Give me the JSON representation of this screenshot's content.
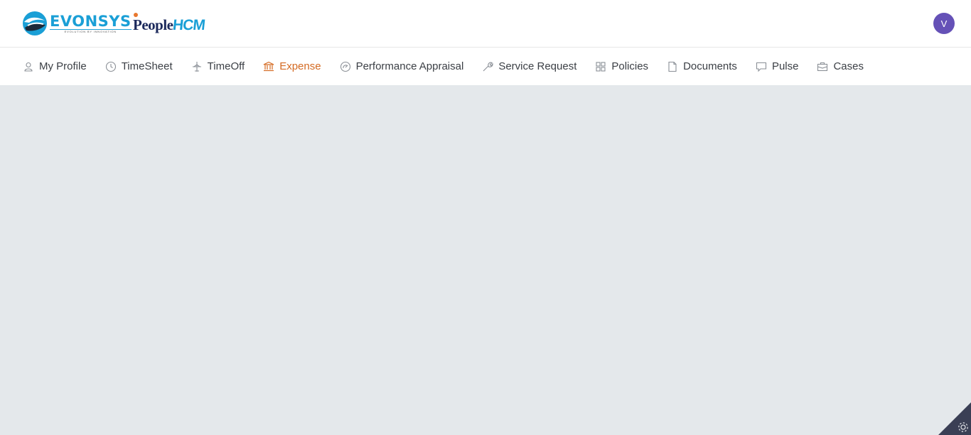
{
  "header": {
    "brand_name": "EVONSYS",
    "brand_tagline": "EVOLUTION BY INNOVATION",
    "product_people": "People",
    "product_hcm": "HCM",
    "avatar_initial": "V",
    "avatar_color": "#6551b7"
  },
  "nav": {
    "items": [
      {
        "label": "My Profile",
        "icon": "user-icon"
      },
      {
        "label": "TimeSheet",
        "icon": "clock-icon"
      },
      {
        "label": "TimeOff",
        "icon": "plane-icon"
      },
      {
        "label": "Expense",
        "icon": "bank-icon",
        "active": true
      },
      {
        "label": "Performance Appraisal",
        "icon": "speedometer-icon"
      },
      {
        "label": "Service Request",
        "icon": "wrench-icon"
      },
      {
        "label": "Policies",
        "icon": "grid-icon"
      },
      {
        "label": "Documents",
        "icon": "document-icon"
      },
      {
        "label": "Pulse",
        "icon": "chat-icon"
      },
      {
        "label": "Cases",
        "icon": "briefcase-icon"
      }
    ],
    "active_color": "#d46a22",
    "text_color": "#3b3f45"
  },
  "colors": {
    "background": "#e4e8eb",
    "brand_blue": "#1a9fd6",
    "corner": "#3a3f55"
  }
}
